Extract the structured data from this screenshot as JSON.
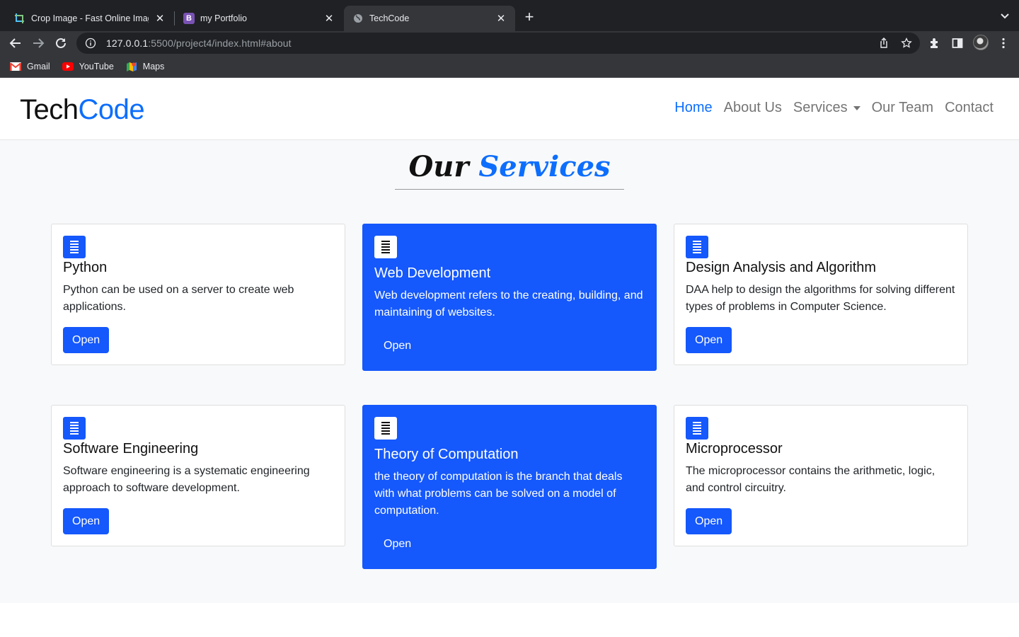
{
  "browser": {
    "tabs": [
      {
        "title": "Crop Image - Fast Online Image",
        "icon": "crop-icon",
        "active": false
      },
      {
        "title": "my Portfolio",
        "icon": "bootstrap-icon",
        "active": false
      },
      {
        "title": "TechCode",
        "icon": "globe-icon",
        "active": true
      }
    ],
    "url_host": "127.0.0.1",
    "url_rest": ":5500/project4/index.html#about",
    "bookmarks": [
      {
        "label": "Gmail",
        "icon": "gmail-icon"
      },
      {
        "label": "YouTube",
        "icon": "youtube-icon"
      },
      {
        "label": "Maps",
        "icon": "maps-icon"
      }
    ],
    "colors": {
      "chrome_dark": "#202124",
      "chrome_toolbar": "#35363a"
    }
  },
  "navbar": {
    "brand_part1": "Tech",
    "brand_part2": "Code",
    "links": [
      {
        "label": "Home",
        "active": true
      },
      {
        "label": "About Us"
      },
      {
        "label": "Services",
        "dropdown": true
      },
      {
        "label": "Our Team"
      },
      {
        "label": "Contact"
      }
    ]
  },
  "services": {
    "heading_part1": "Our",
    "heading_part2": "Services",
    "cards": [
      {
        "title": "Python",
        "text": "Python can be used on a server to create web applications.",
        "button": "Open",
        "featured": false
      },
      {
        "title": "Web Development",
        "text": "Web development refers to the creating, building, and maintaining of websites.",
        "button": "Open",
        "featured": true
      },
      {
        "title": "Design Analysis and Algorithm",
        "text": "DAA help to design the algorithms for solving different types of problems in Computer Science.",
        "button": "Open",
        "featured": false
      },
      {
        "title": "Software Engineering",
        "text": "Software engineering is a systematic engineering approach to software development.",
        "button": "Open",
        "featured": false
      },
      {
        "title": "Theory of Computation",
        "text": "the theory of computation is the branch that deals with what problems can be solved on a model of computation.",
        "button": "Open",
        "featured": true
      },
      {
        "title": "Microprocessor",
        "text": "The microprocessor contains the arithmetic, logic, and control circuitry.",
        "button": "Open",
        "featured": false
      }
    ],
    "card_icon": "document-icon"
  },
  "colors": {
    "accent": "#0d6efd",
    "card_featured": "#1558fb",
    "section_bg": "#f8f9fa"
  }
}
